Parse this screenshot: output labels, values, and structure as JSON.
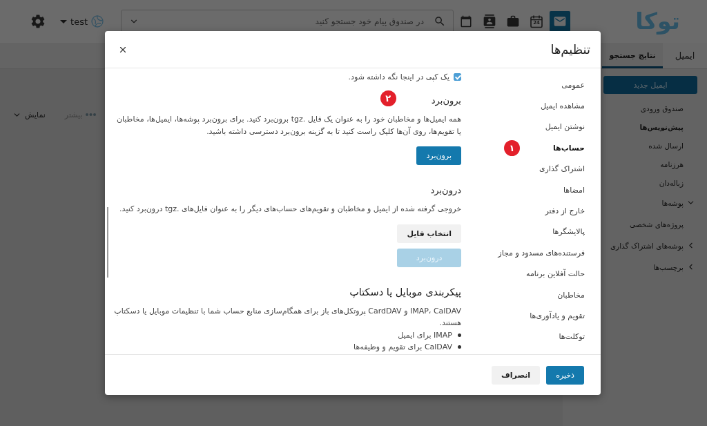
{
  "top_bar": {
    "logo": "توکا",
    "apps": [
      {
        "kind": "mail",
        "selected": true
      },
      {
        "kind": "day",
        "selected": false,
        "day_number": "24"
      },
      {
        "kind": "briefcase",
        "selected": false
      },
      {
        "kind": "contacts",
        "selected": false
      },
      {
        "kind": "calendar",
        "selected": false
      }
    ],
    "search": {
      "placeholder": "در صندوق پیام خود جستجو کنید"
    },
    "user": {
      "name": "test"
    }
  },
  "tab_bar": {
    "module_title": "ایمیل",
    "tabs": [
      {
        "label": "نتایج جستجو",
        "selected": true
      }
    ]
  },
  "sidebar": {
    "new_email_button": "ایمیل جدید",
    "folders": [
      {
        "kind": "folder",
        "label": "صندوق ورودی",
        "unread": false
      },
      {
        "kind": "folder",
        "label": "پیش‌نویس‌ها",
        "unread": true
      },
      {
        "kind": "folder",
        "label": "ارسال شده",
        "unread": false
      },
      {
        "kind": "folder",
        "label": "هرزنامه",
        "unread": false
      },
      {
        "kind": "folder",
        "label": "زباله‌دان",
        "unread": false
      },
      {
        "kind": "group",
        "label": "پوشه‌ها",
        "expanded": true,
        "children": [
          {
            "kind": "folder",
            "label": "پروژه‌های شخصی",
            "unread": false
          }
        ]
      },
      {
        "kind": "group",
        "label": "پوشه‌های اشتراک گذاری",
        "expanded": false
      },
      {
        "kind": "group",
        "label": "برچسب‌ها",
        "expanded": false
      }
    ]
  },
  "toolbar": {
    "more": {
      "label": "بیشتر",
      "disabled": true
    },
    "view": {
      "label": "نمایش"
    }
  },
  "settings_dialog": {
    "title": "تنظیم‌ها",
    "nav": [
      {
        "label": "عمومی",
        "selected": false
      },
      {
        "label": "مشاهده ایمیل",
        "selected": false
      },
      {
        "label": "نوشتن ایمیل",
        "selected": false
      },
      {
        "label": "حساب‌ها",
        "selected": true,
        "marker": "۱"
      },
      {
        "label": "اشتراک گذاری",
        "selected": false
      },
      {
        "label": "امضاها",
        "selected": false
      },
      {
        "label": "خارج از دفتر",
        "selected": false
      },
      {
        "label": "پالایشگرها",
        "selected": false
      },
      {
        "label": "فرستنده‌های مسدود و مجاز",
        "selected": false
      },
      {
        "label": "حالت آفلاین برنامه",
        "selected": false
      },
      {
        "label": "مخاطبان",
        "selected": false
      },
      {
        "label": "تقویم و یادآوری‌ها",
        "selected": false
      },
      {
        "label": "توکلت‌ها",
        "selected": false
      }
    ],
    "keep_copy": {
      "label": "یک کپی در اینجا نگه داشته شود.",
      "checked": true
    },
    "sections": [
      {
        "kind": "subsection",
        "title": "برون‌برد",
        "marker": "۲",
        "paragraph": "همه ایمیل‌ها و مخاطبان خود را به عنوان یک فایل .tgz برون‌برد کنید. برای برون‌برد پوشه‌ها، ایمیل‌ها، مخاطبان یا تقویم‌ها، روی آن‌ها کلیک راست کنید تا به گزینه برون‌برد دسترسی داشته باشید.",
        "buttons": [
          {
            "label": "برون‌برد",
            "kind": "primary",
            "disabled": false
          }
        ]
      },
      {
        "kind": "subsection",
        "title": "درون‌برد",
        "paragraph": "خروجی گرفته شده از ایمیل و مخاطبان و تقویم‌های حساب‌های دیگر را به عنوان فایل‌های .tgz درون‌برد کنید.",
        "buttons": [
          {
            "label": "انتخاب فایل",
            "kind": "secondary",
            "disabled": false
          },
          {
            "label": "درون‌برد",
            "kind": "primary",
            "disabled": true
          }
        ]
      },
      {
        "kind": "section",
        "title": "پیکربندی موبایل یا دسکتاپ",
        "paragraph": "IMAP، CalDAV و CardDAV پروتکل‌های باز برای همگام‌سازی منابع حساب شما با تنظیمات موبایل یا دسکتاپ هستند.",
        "bullets": [
          "IMAP برای ایمیل",
          "CalDAV برای تقویم و وظیفه‌ها"
        ]
      }
    ],
    "footer_buttons": [
      {
        "label": "ذخیره",
        "kind": "primary"
      },
      {
        "label": "انصراف",
        "kind": "secondary"
      }
    ]
  }
}
